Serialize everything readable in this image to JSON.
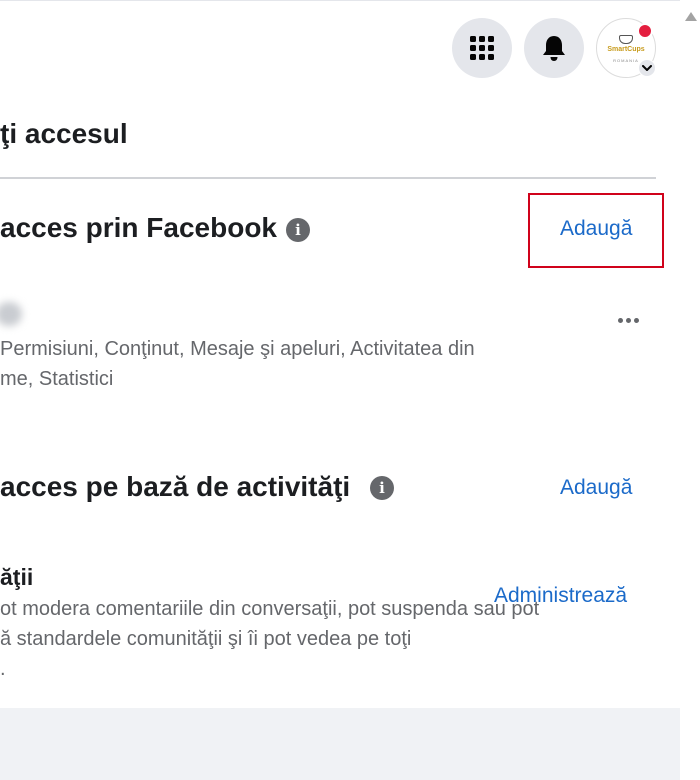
{
  "header": {
    "menu_icon": "grid-menu-icon",
    "bell_icon": "bell-icon",
    "avatar_text": "SmartCups",
    "avatar_sub": "ROMANIA"
  },
  "page": {
    "title": "ţi accesul"
  },
  "facebook_access": {
    "title": "acces prin Facebook",
    "add_label": "Adaugă",
    "person_roles_line1": "Permisiuni, Conţinut, Mesaje şi apeluri, Activitatea din",
    "person_roles_line2": "me, Statistici"
  },
  "task_access": {
    "title": "acces pe bază de activităţi",
    "add_label": "Adaugă",
    "role_title": "ăţii",
    "manage_label": "Administrează",
    "desc_line1": "ot modera comentariile din conversaţii, pot suspenda sau pot",
    "desc_line2": "ă standardele comunităţii şi îi pot vedea pe toţi",
    "desc_line3": "."
  },
  "colors": {
    "link": "#1b6ac9",
    "highlight": "#d0021b",
    "notification": "#e41e3f"
  }
}
